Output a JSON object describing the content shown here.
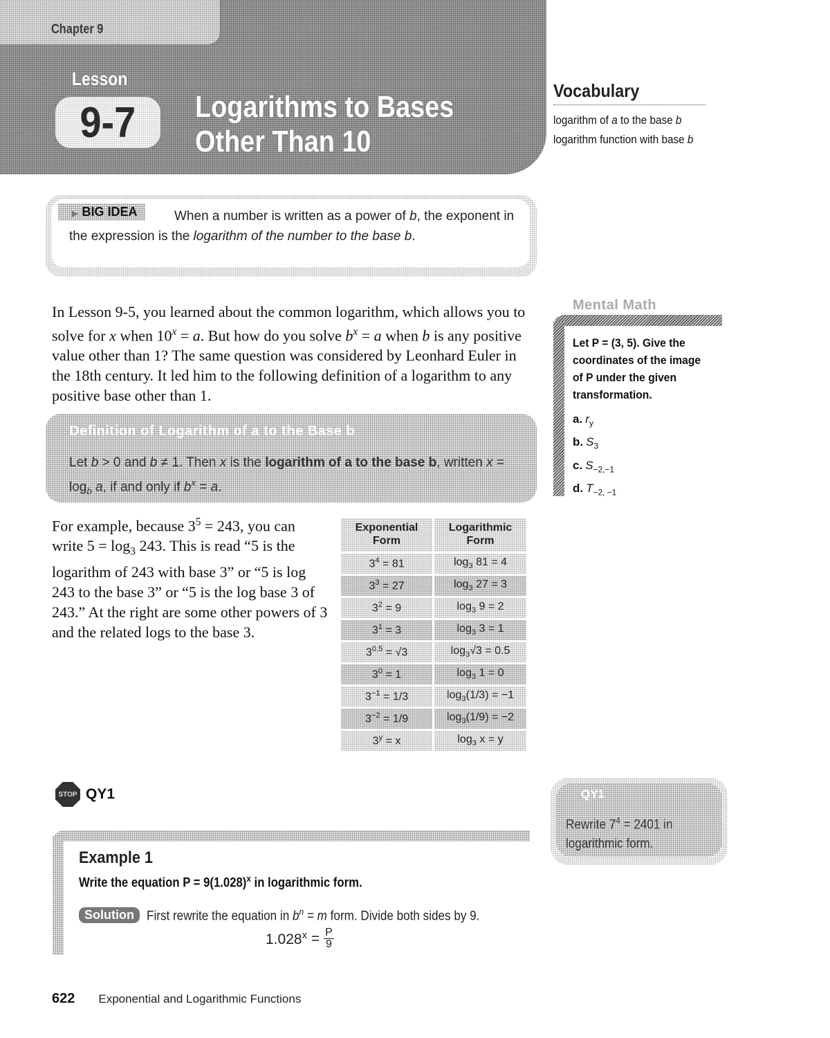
{
  "header": {
    "chapter": "Chapter 9",
    "lesson_word": "Lesson",
    "lesson_number": "9-7",
    "title_line1": "Logarithms to Bases",
    "title_line2": "Other Than 10"
  },
  "vocabulary": {
    "title": "Vocabulary",
    "terms": [
      {
        "pre": "logarithm of ",
        "var1": "a",
        "mid": " to the base ",
        "var2": "b"
      },
      {
        "pre": "logarithm function with base ",
        "var1": "",
        "mid": "",
        "var2": "b"
      }
    ]
  },
  "big_idea": {
    "tag": "BIG IDEA",
    "text_1": "When a number is written as a power of ",
    "var_b": "b",
    "text_2": ", the exponent in the expression is the ",
    "italic": "logarithm of the number to the base b",
    "text_3": "."
  },
  "intro": {
    "s1": "In Lesson 9-5, you learned about the common logarithm, which allows you to solve for ",
    "x": "x",
    "s2": " when 10",
    "s3": " = ",
    "a": "a",
    "s4": ". But how do you solve ",
    "b": "b",
    "s5": " when ",
    "s6": " is any positive value other than 1? The same question was considered by Leonhard Euler in the 18th century. It led him to the following definition of a logarithm to any positive base other than 1."
  },
  "definition": {
    "title": "Definition of Logarithm of a to the Base b",
    "t1": "Let ",
    "t2": " > 0 and ",
    "t3": " ≠ 1. Then ",
    "t4": " is the ",
    "bold": "logarithm of a to the base b",
    "t5": ", written ",
    "t6": " = log",
    "t7": " ",
    "t8": ", if and only if ",
    "t9": " = ",
    "t10": "."
  },
  "example_paragraph": {
    "p1": "For example, because 3",
    "sup5": "5",
    "p2": " = 243, you can write 5 = log",
    "sub3": "3",
    "p3": " 243. This is read “5 is the logarithm of 243 with base 3” or “5 is log 243 to the base 3” or “5 is the log base 3 of 243.” At the right are some other powers of 3 and the related logs to the base 3."
  },
  "table": {
    "headers": [
      "Exponential Form",
      "Logarithmic Form"
    ],
    "rows": [
      {
        "exp_base": "3",
        "exp_pow": "4",
        "exp_rhs": " = 81",
        "log_sub": "3",
        "log_arg": " 81",
        "log_val": " = 4"
      },
      {
        "exp_base": "3",
        "exp_pow": "3",
        "exp_rhs": " = 27",
        "log_sub": "3",
        "log_arg": " 27",
        "log_val": " = 3"
      },
      {
        "exp_base": "3",
        "exp_pow": "2",
        "exp_rhs": " = 9",
        "log_sub": "3",
        "log_arg": " 9",
        "log_val": " = 2"
      },
      {
        "exp_base": "3",
        "exp_pow": "1",
        "exp_rhs": " = 3",
        "log_sub": "3",
        "log_arg": " 3",
        "log_val": " = 1"
      },
      {
        "exp_base": "3",
        "exp_pow": "0.5",
        "exp_rhs": " = √3",
        "log_sub": "3",
        "log_arg": "√3",
        "log_val": " = 0.5"
      },
      {
        "exp_base": "3",
        "exp_pow": "0",
        "exp_rhs": " = 1",
        "log_sub": "3",
        "log_arg": " 1",
        "log_val": " = 0"
      },
      {
        "exp_base": "3",
        "exp_pow": "−1",
        "exp_rhs": " = 1/3",
        "log_sub": "3",
        "log_arg": "(1/3)",
        "log_val": " = −1"
      },
      {
        "exp_base": "3",
        "exp_pow": "−2",
        "exp_rhs": " = 1/9",
        "log_sub": "3",
        "log_arg": "(1/9)",
        "log_val": " = −2"
      },
      {
        "exp_base": "3",
        "exp_pow": "y",
        "exp_rhs": " = x",
        "log_sub": "3",
        "log_arg": " x",
        "log_val": " = y"
      }
    ]
  },
  "mental_math": {
    "title": "Mental Math",
    "prompt": "Let P = (3, 5). Give the coordinates of the image of P under the given transformation.",
    "items": [
      {
        "label": "a.",
        "sym": "r",
        "sub": "y"
      },
      {
        "label": "b.",
        "sym": "S",
        "sub": "3"
      },
      {
        "label": "c.",
        "sym": "S",
        "sub": "−2,−1"
      },
      {
        "label": "d.",
        "sym": "T",
        "sub": "−2, −1"
      }
    ]
  },
  "qy1": {
    "label": "QY1",
    "stop_text": "STOP",
    "box_title": "QY1",
    "box_t1": "Rewrite 7",
    "box_sup": "4",
    "box_t2": " = 2401 in logarithmic form."
  },
  "example1": {
    "title": "Example 1",
    "p1": "Write the equation ",
    "p2": "P = 9(1.028)",
    "p_sup": "x",
    "p3": " in logarithmic form.",
    "solution_label": "Solution",
    "s1": "First rewrite the equation in ",
    "s_b": "b",
    "s_sup": "n",
    "s2": " = ",
    "s_m": "m",
    "s3": " form. Divide both sides by 9.",
    "eq_lhs": "1.028",
    "eq_sup": "x",
    "eq_mid": " = ",
    "eq_num": "P",
    "eq_den": "9"
  },
  "footer": {
    "page_number": "622",
    "title": "Exponential and Logarithmic Functions"
  }
}
